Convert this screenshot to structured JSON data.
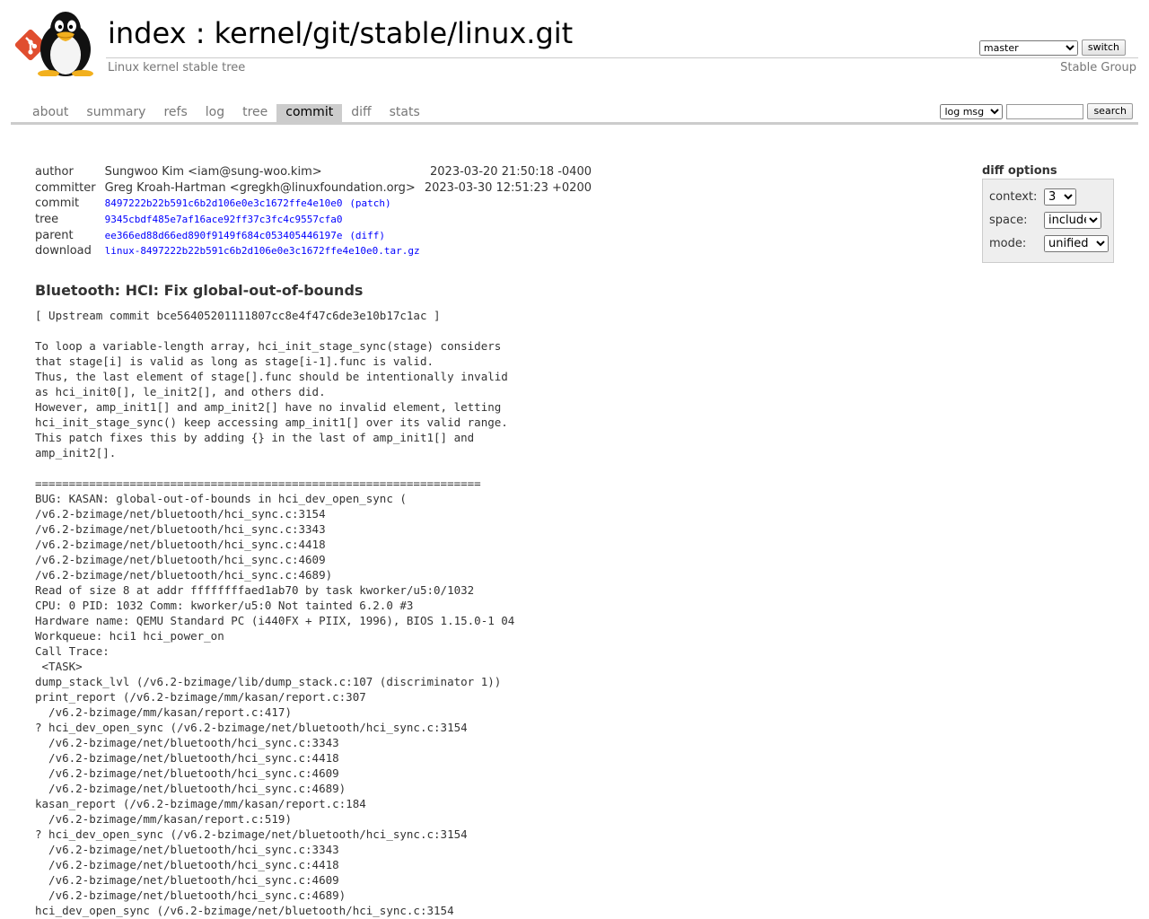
{
  "header": {
    "title_index": "index",
    "title_separator": " : ",
    "title_repo": "kernel/git/stable/linux.git",
    "subtitle": "Linux kernel stable tree",
    "owner": "Stable Group",
    "branch_selected": "master",
    "switch_label": "switch"
  },
  "tabs": [
    {
      "label": "about"
    },
    {
      "label": "summary"
    },
    {
      "label": "refs"
    },
    {
      "label": "log"
    },
    {
      "label": "tree"
    },
    {
      "label": "commit",
      "active": true
    },
    {
      "label": "diff"
    },
    {
      "label": "stats"
    }
  ],
  "search": {
    "scope_selected": "log msg",
    "query": "",
    "button_label": "search"
  },
  "commit_info": {
    "author_label": "author",
    "author": "Sungwoo Kim <iam@sung-woo.kim>",
    "author_date": "2023-03-20 21:50:18 -0400",
    "committer_label": "committer",
    "committer": "Greg Kroah-Hartman <gregkh@linuxfoundation.org>",
    "committer_date": "2023-03-30 12:51:23 +0200",
    "commit_label": "commit",
    "commit_sha": "8497222b22b591c6b2d106e0e3c1672ffe4e10e0",
    "commit_link": "(patch)",
    "tree_label": "tree",
    "tree_sha": "9345cbdf485e7af16ace92ff37c3fc4c9557cfa0",
    "parent_label": "parent",
    "parent_sha": "ee366ed88d66ed890f9149f684c053405446197e",
    "parent_link": "(diff)",
    "download_label": "download",
    "download_file": "linux-8497222b22b591c6b2d106e0e3c1672ffe4e10e0.tar.gz"
  },
  "diff_options": {
    "title": "diff options",
    "context_label": "context:",
    "context_value": "3",
    "space_label": "space:",
    "space_value": "include",
    "mode_label": "mode:",
    "mode_value": "unified"
  },
  "commit_subject": "Bluetooth: HCI: Fix global-out-of-bounds",
  "commit_message": "[ Upstream commit bce56405201111807cc8e4f47c6de3e10b17c1ac ]\n\nTo loop a variable-length array, hci_init_stage_sync(stage) considers\nthat stage[i] is valid as long as stage[i-1].func is valid.\nThus, the last element of stage[].func should be intentionally invalid\nas hci_init0[], le_init2[], and others did.\nHowever, amp_init1[] and amp_init2[] have no invalid element, letting\nhci_init_stage_sync() keep accessing amp_init1[] over its valid range.\nThis patch fixes this by adding {} in the last of amp_init1[] and\namp_init2[].\n\n==================================================================\nBUG: KASAN: global-out-of-bounds in hci_dev_open_sync (\n/v6.2-bzimage/net/bluetooth/hci_sync.c:3154\n/v6.2-bzimage/net/bluetooth/hci_sync.c:3343\n/v6.2-bzimage/net/bluetooth/hci_sync.c:4418\n/v6.2-bzimage/net/bluetooth/hci_sync.c:4609\n/v6.2-bzimage/net/bluetooth/hci_sync.c:4689)\nRead of size 8 at addr ffffffffaed1ab70 by task kworker/u5:0/1032\nCPU: 0 PID: 1032 Comm: kworker/u5:0 Not tainted 6.2.0 #3\nHardware name: QEMU Standard PC (i440FX + PIIX, 1996), BIOS 1.15.0-1 04\nWorkqueue: hci1 hci_power_on\nCall Trace:\n <TASK>\ndump_stack_lvl (/v6.2-bzimage/lib/dump_stack.c:107 (discriminator 1))\nprint_report (/v6.2-bzimage/mm/kasan/report.c:307\n  /v6.2-bzimage/mm/kasan/report.c:417)\n? hci_dev_open_sync (/v6.2-bzimage/net/bluetooth/hci_sync.c:3154\n  /v6.2-bzimage/net/bluetooth/hci_sync.c:3343\n  /v6.2-bzimage/net/bluetooth/hci_sync.c:4418\n  /v6.2-bzimage/net/bluetooth/hci_sync.c:4609\n  /v6.2-bzimage/net/bluetooth/hci_sync.c:4689)\nkasan_report (/v6.2-bzimage/mm/kasan/report.c:184\n  /v6.2-bzimage/mm/kasan/report.c:519)\n? hci_dev_open_sync (/v6.2-bzimage/net/bluetooth/hci_sync.c:3154\n  /v6.2-bzimage/net/bluetooth/hci_sync.c:3343\n  /v6.2-bzimage/net/bluetooth/hci_sync.c:4418\n  /v6.2-bzimage/net/bluetooth/hci_sync.c:4609\n  /v6.2-bzimage/net/bluetooth/hci_sync.c:4689)\nhci_dev_open_sync (/v6.2-bzimage/net/bluetooth/hci_sync.c:3154"
}
